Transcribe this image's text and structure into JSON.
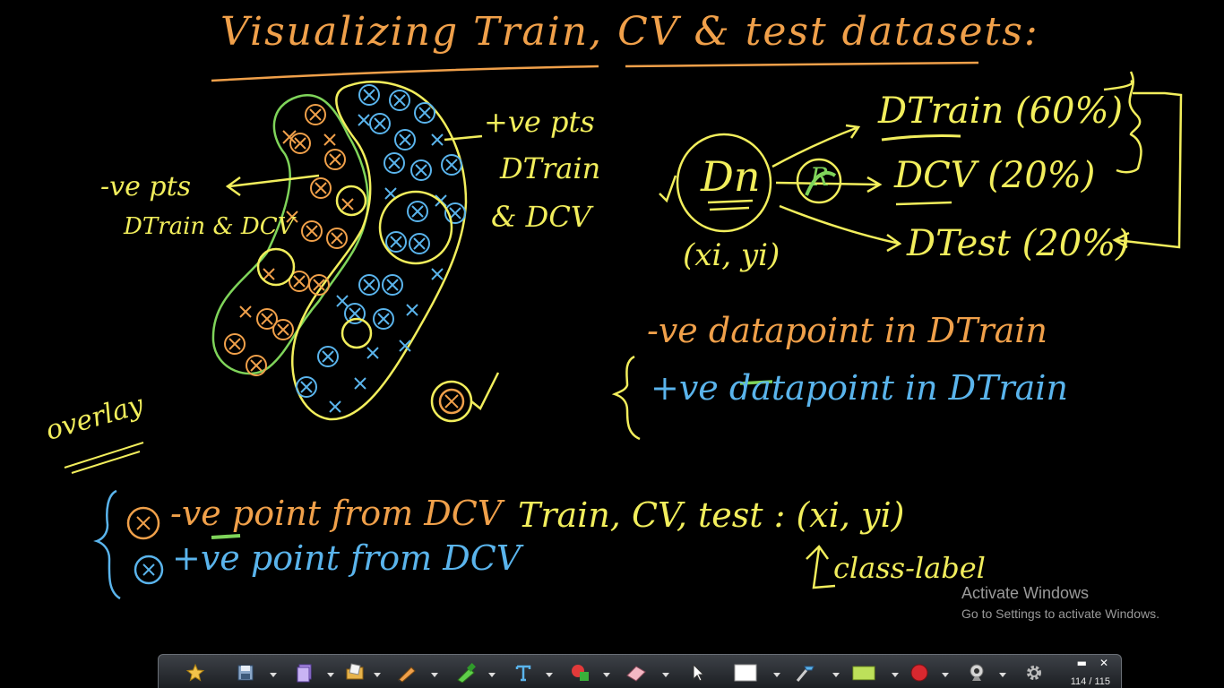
{
  "title": "Visualizing Train, CV & test datasets:",
  "left_note": {
    "line1": "-ve pts",
    "line2": "DTrain & DCV"
  },
  "right_note": {
    "line1": "+ve pts",
    "line2": "DTrain",
    "line3": "& DCV"
  },
  "overlay_label": "overlay",
  "legend_dcv": {
    "neg": "-ve point from DCV",
    "pos": "+ve point from DCV"
  },
  "dataset": {
    "dn": "Dn",
    "xy": "(xi, yi)",
    "r": "R",
    "train": "DTrain (60%)",
    "cv": "DCV (20%)",
    "test": "DTest (20%)"
  },
  "legend_train": {
    "neg": "-ve datapoint in DTrain",
    "pos": "+ve datapoint in DTrain"
  },
  "tuple_line": "Train, CV, test :  (xi, yi)",
  "class_label": "class-label",
  "watermark": {
    "title": "Activate Windows",
    "subtitle": "Go to Settings to activate Windows."
  },
  "toolbar": {
    "page_counter": "114 / 115",
    "minimize": "▬",
    "close": "✕"
  },
  "colors": {
    "orange": "#f0a04a",
    "yellow": "#f2ee5c",
    "blue": "#5ab4ec",
    "green": "#7fd45a"
  }
}
